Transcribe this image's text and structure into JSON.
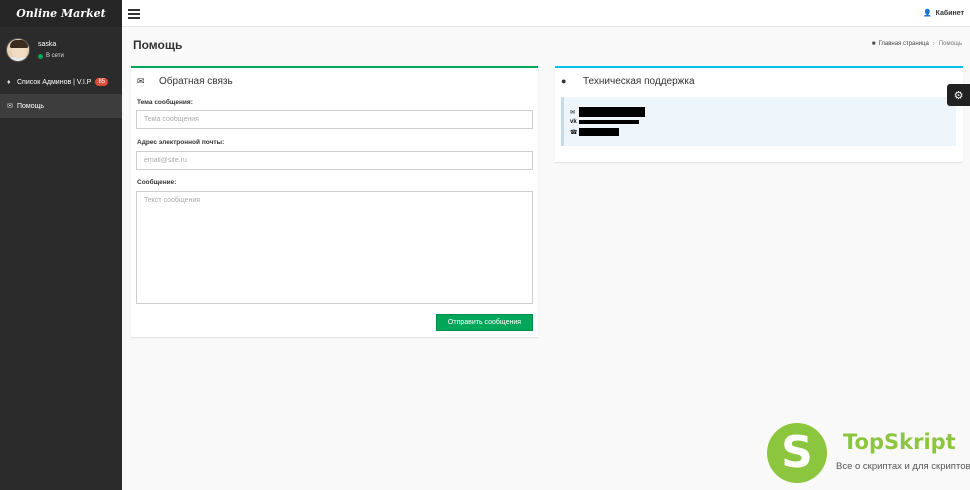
{
  "sidebar": {
    "brand": "Online Market",
    "user": {
      "name": "saska",
      "status": "В сети"
    },
    "items": [
      {
        "label": "Список Админов | V.I.P",
        "badge": "85",
        "icon": "user-secret-icon"
      },
      {
        "label": "Помощь",
        "icon": "envelope-icon"
      }
    ]
  },
  "topbar": {
    "account_label": "Кабинет"
  },
  "page": {
    "title": "Помощь",
    "breadcrumb": {
      "home": "Главная страница",
      "current": "Помощь"
    }
  },
  "feedback": {
    "title": "Обратная связь",
    "subject_label": "Тема сообщения:",
    "subject_placeholder": "Тема сообщения",
    "email_label": "Адрес электронной почты:",
    "email_placeholder": "email@site.ru",
    "message_label": "Сообщение:",
    "message_placeholder": "Текст сообщения",
    "submit_label": "Отправить сообщения"
  },
  "support": {
    "title": "Техническая поддержка",
    "contacts": [
      {
        "icon": "envelope-icon"
      },
      {
        "icon": "vk-icon"
      },
      {
        "icon": "skype-icon"
      }
    ]
  },
  "watermark": {
    "title": "TopSkript",
    "subtitle": "Все о скриптах и для скриптов...",
    "letter": "S"
  },
  "colors": {
    "accent_green": "#00a65a",
    "accent_blue": "#00c0ef",
    "sidebar_bg": "#2b2b2b",
    "watermark_green": "#8cc63e"
  }
}
